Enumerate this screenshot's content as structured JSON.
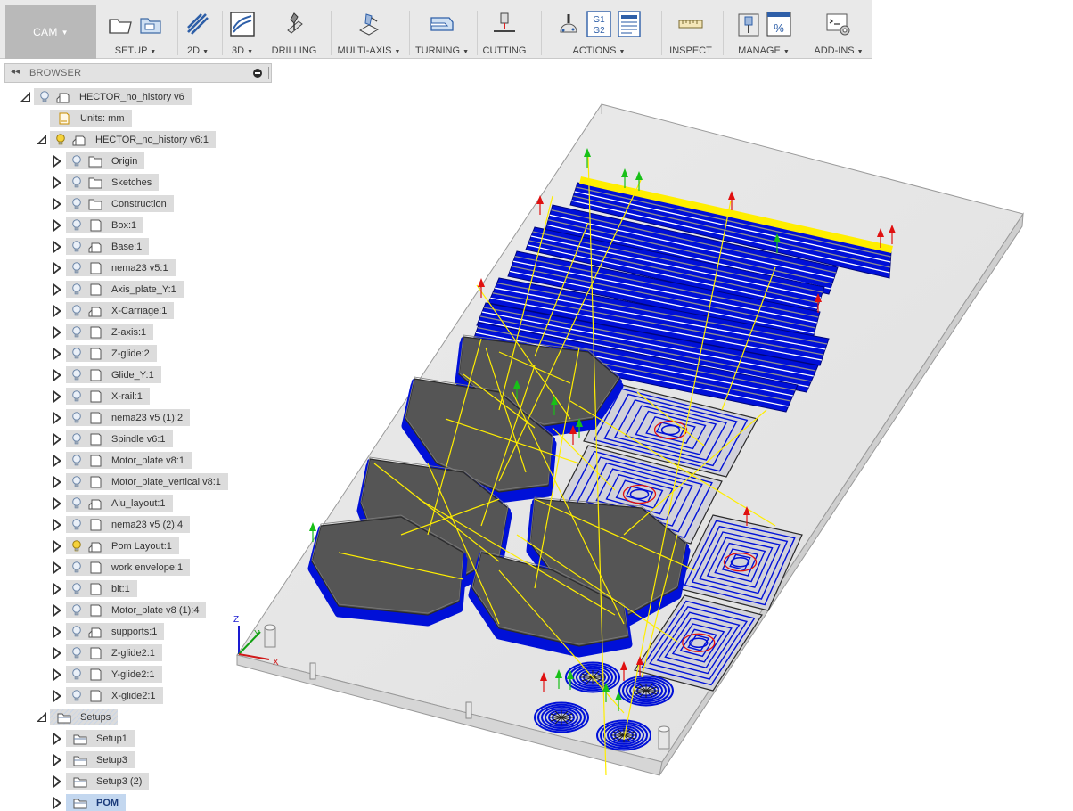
{
  "workspace": {
    "label": "CAM"
  },
  "toolbar": {
    "groups": [
      {
        "id": "setup",
        "label": "SETUP",
        "dropdown": true
      },
      {
        "id": "2d",
        "label": "2D",
        "dropdown": true
      },
      {
        "id": "3d",
        "label": "3D",
        "dropdown": true
      },
      {
        "id": "drilling",
        "label": "DRILLING",
        "dropdown": false
      },
      {
        "id": "multi-axis",
        "label": "MULTI-AXIS",
        "dropdown": true
      },
      {
        "id": "turning",
        "label": "TURNING",
        "dropdown": true
      },
      {
        "id": "cutting",
        "label": "CUTTING",
        "dropdown": false
      },
      {
        "id": "actions",
        "label": "ACTIONS",
        "dropdown": true
      },
      {
        "id": "inspect",
        "label": "INSPECT",
        "dropdown": false
      },
      {
        "id": "manage",
        "label": "MANAGE",
        "dropdown": true
      },
      {
        "id": "add-ins",
        "label": "ADD-INS",
        "dropdown": true
      }
    ],
    "g1g2_line1": "G1",
    "g1g2_line2": "G2",
    "percent_symbol": "%",
    "caret": "▼"
  },
  "browser": {
    "title": "BROWSER",
    "collapse_glyph": "◂◂",
    "root": {
      "label": "HECTOR_no_history v6",
      "units": "Units: mm"
    },
    "component": {
      "label": "HECTOR_no_history v6:1"
    },
    "items": [
      {
        "label": "Origin",
        "icon": "folder"
      },
      {
        "label": "Sketches",
        "icon": "folder"
      },
      {
        "label": "Construction",
        "icon": "folder"
      },
      {
        "label": "Box:1",
        "icon": "component"
      },
      {
        "label": "Base:1",
        "icon": "component-linked"
      },
      {
        "label": "nema23 v5:1",
        "icon": "component"
      },
      {
        "label": "Axis_plate_Y:1",
        "icon": "component"
      },
      {
        "label": "X-Carriage:1",
        "icon": "component-linked"
      },
      {
        "label": "Z-axis:1",
        "icon": "component"
      },
      {
        "label": "Z-glide:2",
        "icon": "component"
      },
      {
        "label": "Glide_Y:1",
        "icon": "component"
      },
      {
        "label": "X-rail:1",
        "icon": "component"
      },
      {
        "label": "nema23 v5 (1):2",
        "icon": "component"
      },
      {
        "label": "Spindle v6:1",
        "icon": "component"
      },
      {
        "label": "Motor_plate v8:1",
        "icon": "component"
      },
      {
        "label": "Motor_plate_vertical v8:1",
        "icon": "component"
      },
      {
        "label": "Alu_layout:1",
        "icon": "component-linked"
      },
      {
        "label": "nema23 v5 (2):4",
        "icon": "component"
      },
      {
        "label": "Pom Layout:1",
        "icon": "component-linked",
        "lit": true
      },
      {
        "label": "work envelope:1",
        "icon": "component"
      },
      {
        "label": "bit:1",
        "icon": "component"
      },
      {
        "label": "Motor_plate v8 (1):4",
        "icon": "component"
      },
      {
        "label": "supports:1",
        "icon": "component-linked"
      },
      {
        "label": "Z-glide2:1",
        "icon": "component"
      },
      {
        "label": "Y-glide2:1",
        "icon": "component"
      },
      {
        "label": "X-glide2:1",
        "icon": "component"
      }
    ],
    "setups_folder": {
      "label": "Setups"
    },
    "setups": [
      {
        "label": "Setup1"
      },
      {
        "label": "Setup3"
      },
      {
        "label": "Setup3 (2)"
      },
      {
        "label": "POM",
        "selected": true
      }
    ]
  },
  "viewport": {
    "triad": {
      "x": "X",
      "y": "Y",
      "z": "Z"
    },
    "colors": {
      "toolpath": "#0010d8",
      "rapid": "#ffee00",
      "part": "#555555",
      "stock": "#e2e2e2",
      "entry": "#18c018",
      "exit": "#e01010"
    }
  }
}
